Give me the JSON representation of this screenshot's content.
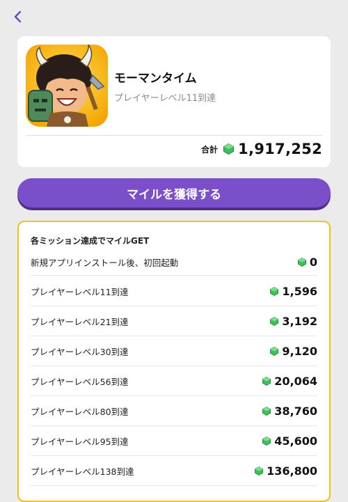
{
  "nav": {
    "back_icon": "chevron-left-icon"
  },
  "app": {
    "title": "モーマンタイム",
    "subtitle": "プレイヤーレベル11到達",
    "icon": "caveman-app-icon",
    "total_label": "合計",
    "total_value": "1,917,252"
  },
  "cta": {
    "label": "マイルを獲得する"
  },
  "missions": {
    "title": "各ミッション達成でマイルGET",
    "items": [
      {
        "label": "新規アプリインストール後、初回起動",
        "value": "0"
      },
      {
        "label": "プレイヤーレベル11到達",
        "value": "1,596"
      },
      {
        "label": "プレイヤーレベル21到達",
        "value": "3,192"
      },
      {
        "label": "プレイヤーレベル30到達",
        "value": "9,120"
      },
      {
        "label": "プレイヤーレベル56到達",
        "value": "20,064"
      },
      {
        "label": "プレイヤーレベル80到達",
        "value": "38,760"
      },
      {
        "label": "プレイヤーレベル95到達",
        "value": "45,600"
      },
      {
        "label": "プレイヤーレベル138到達",
        "value": "136,800"
      }
    ]
  },
  "colors": {
    "accent": "#7b4fc9",
    "gem": "#3fbf5a",
    "mission_border": "#f2c21a",
    "background": "#ebebeb"
  }
}
